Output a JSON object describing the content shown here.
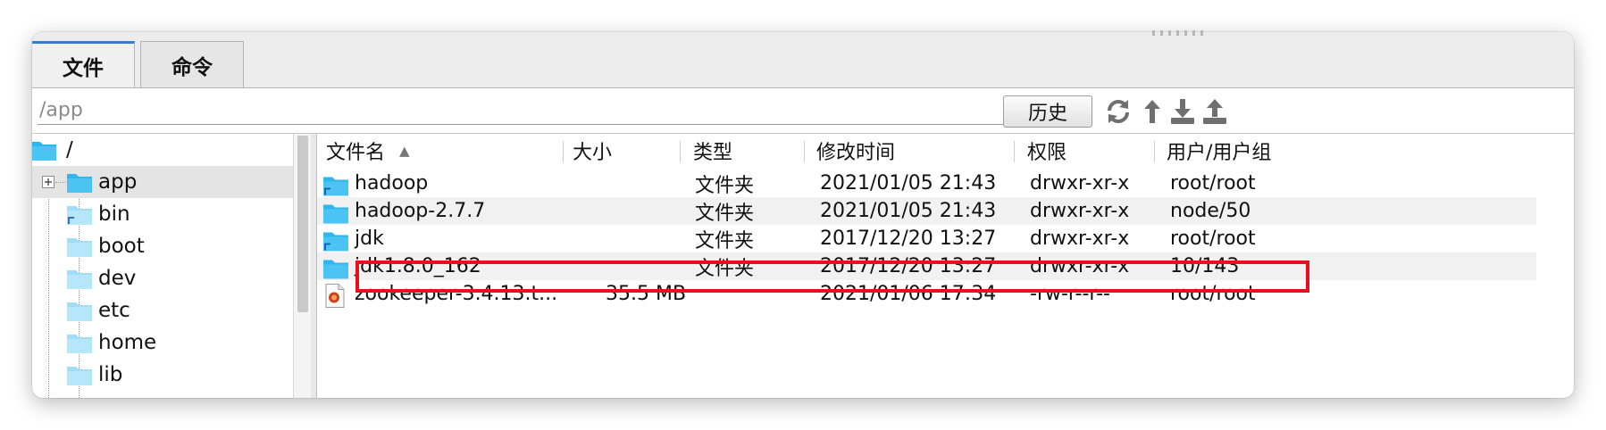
{
  "tabs": [
    {
      "label": "文件",
      "active": true
    },
    {
      "label": "命令",
      "active": false
    }
  ],
  "path": {
    "value": "/app"
  },
  "toolbar": {
    "history_label": "历史",
    "icons": [
      "refresh-icon",
      "go-up-icon",
      "download-icon",
      "upload-icon"
    ]
  },
  "tree": {
    "root": "/",
    "items": [
      {
        "label": "app",
        "selected": true,
        "expandable": true
      },
      {
        "label": "bin",
        "link": true
      },
      {
        "label": "boot"
      },
      {
        "label": "dev"
      },
      {
        "label": "etc"
      },
      {
        "label": "home"
      },
      {
        "label": "lib"
      }
    ]
  },
  "table": {
    "columns": [
      "文件名",
      "大小",
      "类型",
      "修改时间",
      "权限",
      "用户/用户组"
    ],
    "sort_indicator": "▲",
    "rows": [
      {
        "name": "hadoop",
        "size": "",
        "type": "文件夹",
        "modified": "2021/01/05 21:43",
        "perm": "drwxr-xr-x",
        "owner": "root/root",
        "icon": "folder-link-icon"
      },
      {
        "name": "hadoop-2.7.7",
        "size": "",
        "type": "文件夹",
        "modified": "2021/01/05 21:43",
        "perm": "drwxr-xr-x",
        "owner": "node/50",
        "icon": "folder-icon"
      },
      {
        "name": "jdk",
        "size": "",
        "type": "文件夹",
        "modified": "2017/12/20 13:27",
        "perm": "drwxr-xr-x",
        "owner": "root/root",
        "icon": "folder-link-icon"
      },
      {
        "name": "jdk1.8.0_162",
        "size": "",
        "type": "文件夹",
        "modified": "2017/12/20 13:27",
        "perm": "drwxr-xr-x",
        "owner": "10/143",
        "icon": "folder-icon"
      },
      {
        "name": "zookeeper-3.4.13.t...",
        "size": "35.5 MB",
        "type": "",
        "modified": "2021/01/06 17:34",
        "perm": "-rw-r--r--",
        "owner": "root/root",
        "icon": "archive-file-icon"
      }
    ]
  },
  "colors": {
    "accent": "#2f7fd8",
    "folder": "#2fb6ee",
    "highlight": "#e8101e"
  }
}
